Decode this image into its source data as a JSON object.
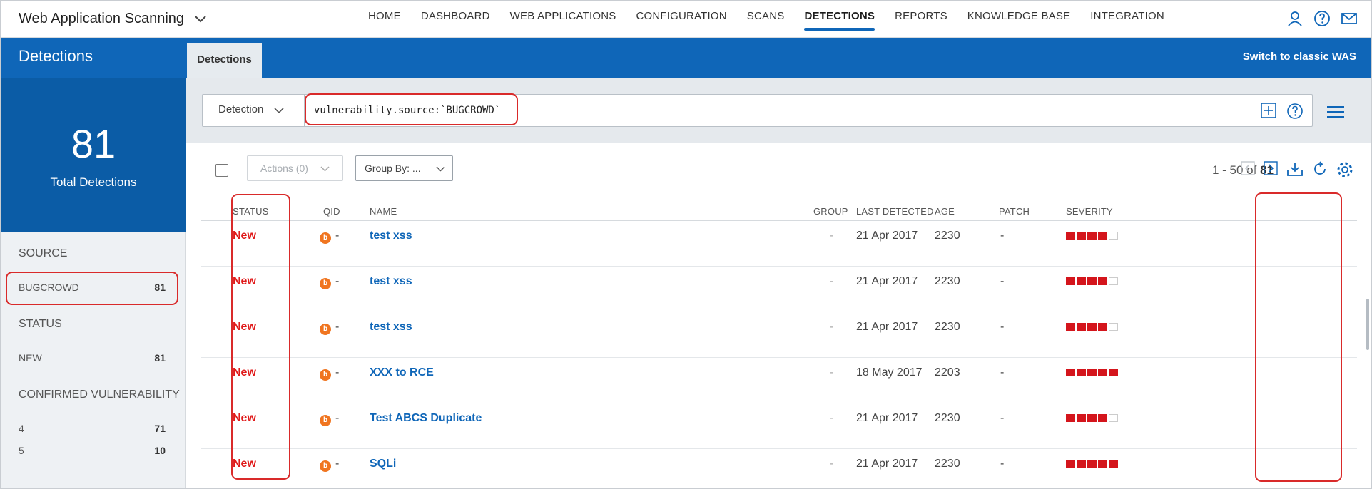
{
  "app": {
    "title": "Web Application Scanning"
  },
  "nav": [
    {
      "label": "HOME",
      "active": false
    },
    {
      "label": "DASHBOARD",
      "active": false
    },
    {
      "label": "WEB APPLICATIONS",
      "active": false
    },
    {
      "label": "CONFIGURATION",
      "active": false
    },
    {
      "label": "SCANS",
      "active": false
    },
    {
      "label": "DETECTIONS",
      "active": true
    },
    {
      "label": "REPORTS",
      "active": false
    },
    {
      "label": "KNOWLEDGE BASE",
      "active": false
    },
    {
      "label": "INTEGRATION",
      "active": false
    }
  ],
  "header": {
    "title": "Detections",
    "tab": "Detections",
    "switch_label": "Switch to classic WAS"
  },
  "summary": {
    "total": "81",
    "label": "Total Detections"
  },
  "facets": {
    "source": {
      "title": "SOURCE",
      "items": [
        {
          "label": "BUGCROWD",
          "count": "81"
        }
      ]
    },
    "status": {
      "title": "STATUS",
      "items": [
        {
          "label": "NEW",
          "count": "81"
        }
      ]
    },
    "confirmed": {
      "title": "CONFIRMED VULNERABILITY",
      "items": [
        {
          "label": "4",
          "count": "71"
        },
        {
          "label": "5",
          "count": "10"
        }
      ]
    }
  },
  "search": {
    "field": "Detection",
    "query": "vulnerability.source:`BUGCROWD`"
  },
  "toolbar": {
    "actions": "Actions (0)",
    "group_by": "Group By: ...",
    "range": "1 - 50 of",
    "total": "81"
  },
  "table": {
    "columns": [
      "STATUS",
      "QID",
      "NAME",
      "GROUP",
      "LAST DETECTED",
      "AGE",
      "PATCH",
      "SEVERITY"
    ],
    "rows": [
      {
        "status": "New",
        "qid": "-",
        "name": "test xss",
        "group": "-",
        "last_detected": "21 Apr 2017",
        "age": "2230",
        "patch": "-",
        "severity": 4
      },
      {
        "status": "New",
        "qid": "-",
        "name": "test xss",
        "group": "-",
        "last_detected": "21 Apr 2017",
        "age": "2230",
        "patch": "-",
        "severity": 4
      },
      {
        "status": "New",
        "qid": "-",
        "name": "test xss",
        "group": "-",
        "last_detected": "21 Apr 2017",
        "age": "2230",
        "patch": "-",
        "severity": 4
      },
      {
        "status": "New",
        "qid": "-",
        "name": "XXX to RCE",
        "group": "-",
        "last_detected": "18 May 2017",
        "age": "2203",
        "patch": "-",
        "severity": 5
      },
      {
        "status": "New",
        "qid": "-",
        "name": "Test ABCS Duplicate",
        "group": "-",
        "last_detected": "21 Apr 2017",
        "age": "2230",
        "patch": "-",
        "severity": 4
      },
      {
        "status": "New",
        "qid": "-",
        "name": "SQLi",
        "group": "-",
        "last_detected": "21 Apr 2017",
        "age": "2230",
        "patch": "-",
        "severity": 5
      }
    ]
  },
  "icons": {
    "bugcrowd": "b"
  },
  "colors": {
    "brand": "#0f66b8",
    "status_new": "#e01b1b",
    "severity": "#d4151c",
    "highlight": "#d92a2a"
  }
}
